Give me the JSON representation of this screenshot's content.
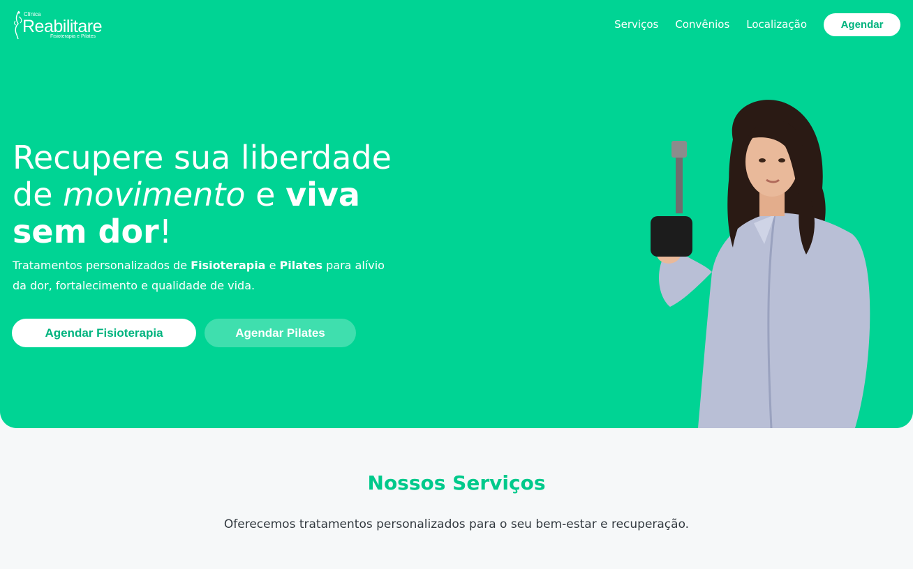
{
  "brand": {
    "prefix": "Clínica",
    "name": "Reabilitare",
    "tagline": "Fisioterapia e Pilates"
  },
  "nav": {
    "links": [
      "Serviços",
      "Convênios",
      "Localização"
    ],
    "cta": "Agendar"
  },
  "hero": {
    "title_part1": "Recupere sua liberdade de ",
    "title_em": "movimento",
    "title_part2": " e ",
    "title_strong": "viva sem dor",
    "title_end": "!",
    "desc_part1": "Tratamentos personalizados de ",
    "desc_b1": "Fisioterapia",
    "desc_part2": " e ",
    "desc_b2": "Pilates",
    "desc_part3": " para alívio da dor, fortalecimento e qualidade de vida.",
    "btn_primary": "Agendar Fisioterapia",
    "btn_secondary": "Agendar Pilates"
  },
  "services": {
    "title": "Nossos Serviços",
    "subtitle": "Oferecemos tratamentos personalizados para o seu bem-estar e recuperação."
  },
  "colors": {
    "hero_bg": "#00d494",
    "accent": "#00b37e",
    "page_bg": "#f6f8f9"
  },
  "icons": {
    "logo": "leaf-figure-icon"
  }
}
